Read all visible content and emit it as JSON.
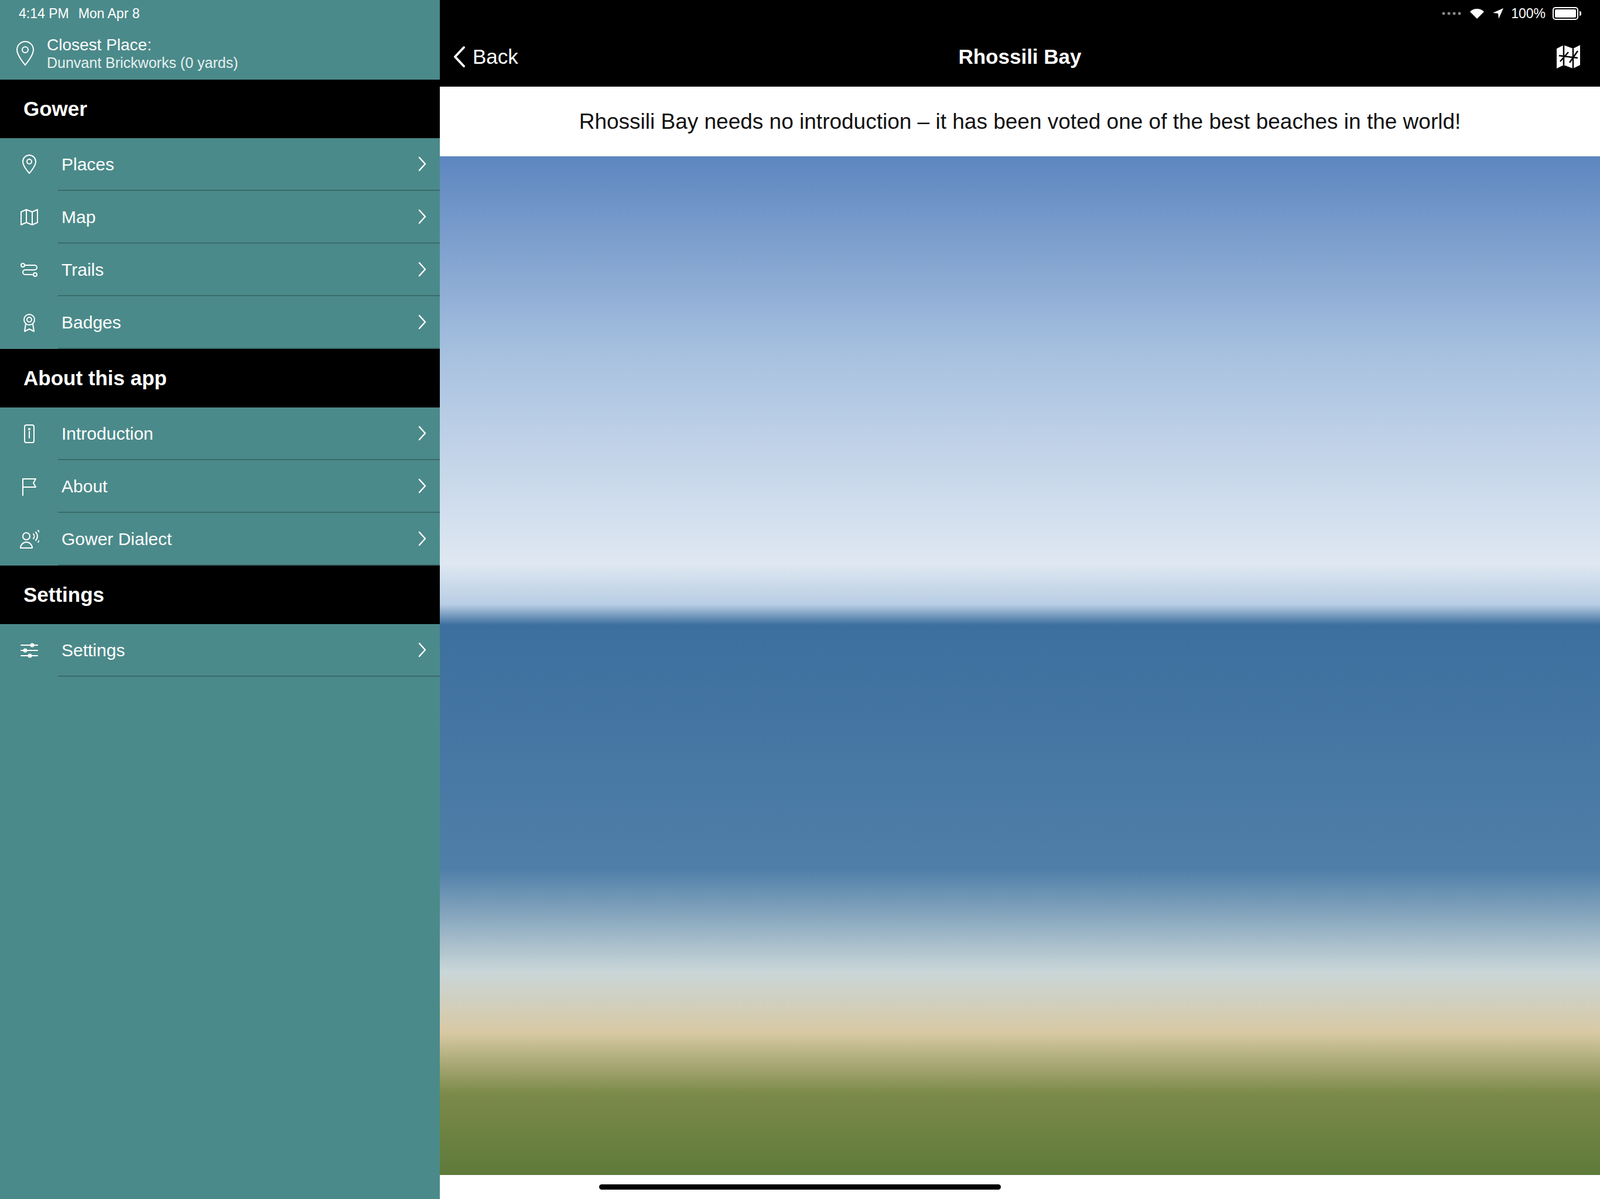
{
  "status_bar": {
    "time": "4:14 PM",
    "date": "Mon Apr 8",
    "battery": "100%",
    "battery_level": 1.0
  },
  "closest_place": {
    "label": "Closest Place:",
    "value": "Dunvant Brickworks (0 yards)"
  },
  "sidebar": {
    "sections": [
      {
        "title": "Gower",
        "items": [
          {
            "label": "Places"
          },
          {
            "label": "Map"
          },
          {
            "label": "Trails"
          },
          {
            "label": "Badges"
          }
        ]
      },
      {
        "title": "About this app",
        "items": [
          {
            "label": "Introduction"
          },
          {
            "label": "About"
          },
          {
            "label": "Gower Dialect"
          }
        ]
      },
      {
        "title": "Settings",
        "items": [
          {
            "label": "Settings"
          }
        ]
      }
    ]
  },
  "nav": {
    "back": "Back",
    "title": "Rhossili Bay"
  },
  "description": "Rhossili Bay needs no introduction – it has been voted one of the best beaches in the world!"
}
